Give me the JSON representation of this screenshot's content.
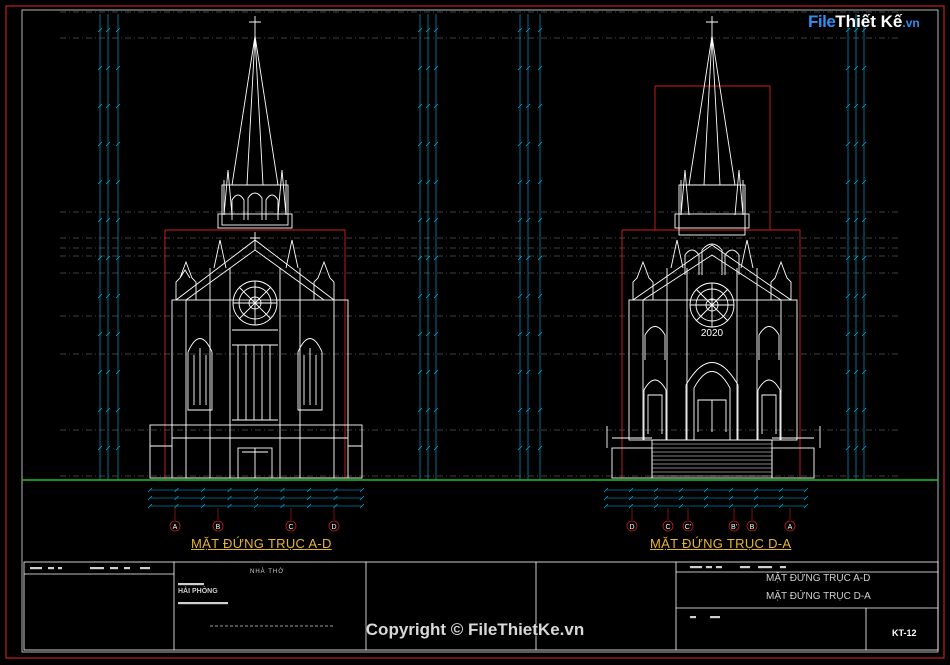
{
  "drawing": {
    "left_view_title": "MẶT ĐỨNG TRỤC A-D",
    "right_view_title": "MẶT ĐỨNG TRỤC D-A",
    "left_axes": [
      "A",
      "B",
      "C",
      "D"
    ],
    "right_axes": [
      "D",
      "C",
      "C'",
      "B'",
      "B",
      "A"
    ],
    "rose_window_year": "2020",
    "colors": {
      "background": "#000000",
      "outline": "#ffffff",
      "dimension": "#00c8ff",
      "section_box": "#d02020",
      "ground": "#1fbf1f",
      "title_text": "#e8b62c"
    }
  },
  "title_block": {
    "project_name": "NHÀ THỜ",
    "location": "HẢI PHÒNG",
    "sheet_title_1": "MẶT ĐỨNG TRỤC A-D",
    "sheet_title_2": "MẶT ĐỨNG TRỤC D-A",
    "sheet_number": "KT-12"
  },
  "watermark": {
    "logo_part_1": "File",
    "logo_part_2": "Thiết Kế",
    "logo_part_3": ".vn",
    "copyright": "Copyright © FileThietKe.vn"
  }
}
